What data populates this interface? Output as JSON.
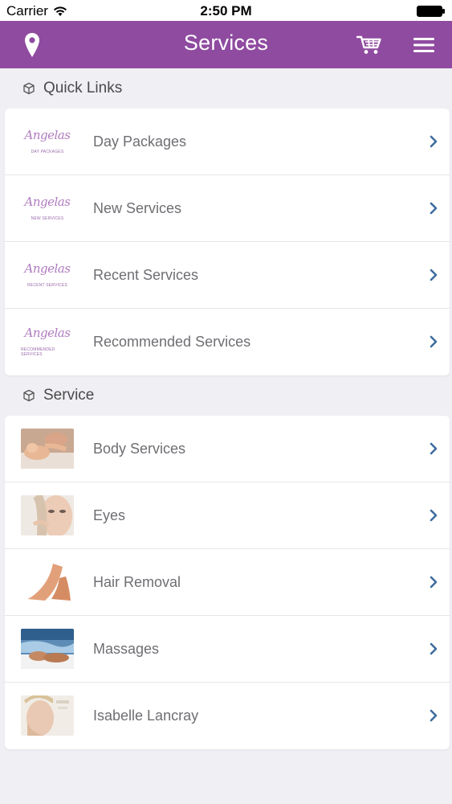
{
  "status_bar": {
    "carrier": "Carrier",
    "time": "2:50 PM"
  },
  "nav": {
    "title": "Services",
    "left_icon": "location-pin-icon",
    "cart_icon": "cart-icon",
    "menu_icon": "hamburger-menu-icon",
    "bar_color": "#8f4ba0"
  },
  "quick_links": {
    "header": "Quick Links",
    "logo_text": "Angelas",
    "items": [
      {
        "label": "Day Packages",
        "logo_caption": "DAY PACKAGES"
      },
      {
        "label": "New Services",
        "logo_caption": "NEW SERVICES"
      },
      {
        "label": "Recent Services",
        "logo_caption": "RECENT SERVICES"
      },
      {
        "label": "Recommended Services",
        "logo_caption": "RECOMMENDED SERVICES"
      }
    ]
  },
  "services": {
    "header": "Service",
    "items": [
      {
        "label": "Body Services",
        "thumb": "body-services-photo"
      },
      {
        "label": "Eyes",
        "thumb": "eyes-photo"
      },
      {
        "label": "Hair Removal",
        "thumb": "hair-removal-photo"
      },
      {
        "label": "Massages",
        "thumb": "massages-photo"
      },
      {
        "label": "Isabelle Lancray",
        "thumb": "isabelle-lancray-photo"
      }
    ]
  },
  "colors": {
    "accent": "#8f4ba0",
    "chevron": "#3f6d9e",
    "background": "#efeff4"
  }
}
